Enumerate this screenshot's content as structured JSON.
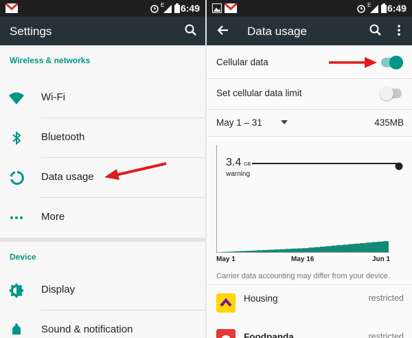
{
  "left": {
    "status_time": "6:49",
    "status_lte": "E",
    "title": "Settings",
    "sections": [
      {
        "header": "Wireless & networks",
        "items": [
          {
            "label": "Wi-Fi",
            "icon": "wifi-icon"
          },
          {
            "label": "Bluetooth",
            "icon": "bluetooth-icon"
          },
          {
            "label": "Data usage",
            "icon": "data-usage-icon"
          },
          {
            "label": "More",
            "icon": "more-dots-icon"
          }
        ]
      },
      {
        "header": "Device",
        "items": [
          {
            "label": "Display",
            "icon": "brightness-icon"
          },
          {
            "label": "Sound & notification",
            "icon": "bell-icon"
          }
        ]
      }
    ]
  },
  "right": {
    "status_time": "6:49",
    "status_lte": "E",
    "title": "Data usage",
    "cellular_data": {
      "label": "Cellular data",
      "enabled": true
    },
    "cellular_limit": {
      "label": "Set cellular data limit",
      "enabled": false
    },
    "cycle": {
      "range": "May 1 – 31",
      "total": "435MB"
    },
    "chart": {
      "warning_value": "3.4",
      "warning_unit": "GB",
      "warning_label": "warning",
      "x_labels": [
        "May 1",
        "May 16",
        "Jun 1"
      ]
    },
    "note": "Carrier data accounting may differ from your device.",
    "apps": [
      {
        "name": "Housing",
        "status": "restricted"
      },
      {
        "name": "Foodpanda",
        "status": "restricted"
      }
    ]
  },
  "colors": {
    "accent": "#009688",
    "appbar": "#263238",
    "statusbar": "#1f1f1f",
    "arrow": "#e01b1b",
    "chart_fill": "#138a78"
  },
  "chart_data": {
    "type": "area",
    "x": [
      "May 1",
      "May 16",
      "Jun 1"
    ],
    "series": [
      {
        "values": [
          0,
          0.15,
          0.43
        ]
      }
    ],
    "warning_line_gb": 3.4
  }
}
